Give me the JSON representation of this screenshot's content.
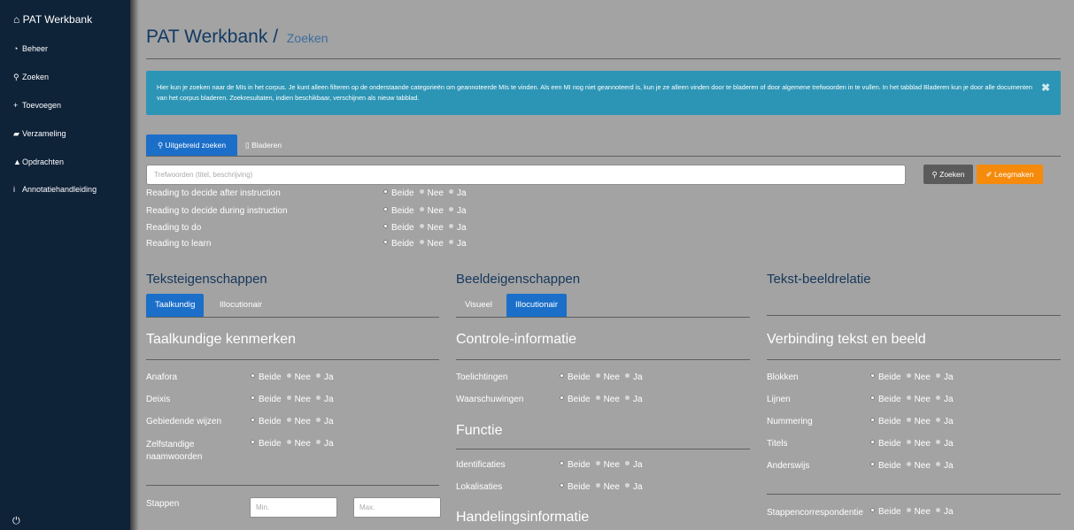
{
  "sidebar": {
    "brand": "PAT Werkbank",
    "items": [
      {
        "icon": "home-icon",
        "glyph": "🏠",
        "label": "PAT Werkbank"
      },
      {
        "icon": "dashboard-icon",
        "label": "Beheer"
      },
      {
        "icon": "search-icon",
        "label": "Zoeken"
      },
      {
        "icon": "plus-icon",
        "label": "Toevoegen"
      },
      {
        "icon": "book-icon",
        "label": "Verzameling"
      },
      {
        "icon": "graduation-cap-icon",
        "label": "Opdrachten"
      },
      {
        "icon": "info-icon",
        "label": "Annotatiehandleiding"
      }
    ],
    "power_icon": "power-icon"
  },
  "header": {
    "title": "PAT Werkbank",
    "separator": "/",
    "subtitle": "Zoeken"
  },
  "alert": {
    "text": "Hier kun je zoeken naar de MIs in het corpus. Je kunt alleen filteren op de onderstaande categorieën om geannoteerde MIs te vinden. Als een MI nog niet geannoteerd is, kun je ze alleen vinden door te bladeren of door algemene trefwoorden in te vullen. In het tabblad Bladeren kun je door alle documenten van het corpus bladeren. Zoekresultaten, indien beschikbaar, verschijnen als nieuw tabblad.",
    "close": "✖"
  },
  "tabs": {
    "advanced": "Uitgebreid zoeken",
    "browse": "Bladeren"
  },
  "search": {
    "placeholder": "Trefwoorden (titel, beschrijving)",
    "search_button": "Zoeken",
    "clear_button": "Leegmaken"
  },
  "options": {
    "both": "Beide",
    "no": "Nee",
    "yes": "Ja"
  },
  "reading_filters": [
    "Reading to decide after instruction",
    "Reading to decide during instruction",
    "Reading to do",
    "Reading to learn"
  ],
  "columns": {
    "text_props": {
      "heading": "Teksteigenschappen",
      "tabs": [
        "Taalkundig",
        "Illocutionair"
      ],
      "active_tab": "Taalkundig",
      "subheading": "Taalkundige kenmerken",
      "rows": [
        "Anafora",
        "Deixis",
        "Gebiedende wijzen",
        "Zelfstandige naamwoorden"
      ],
      "steps_label": "Stappen",
      "min_placeholder": "Min.",
      "max_placeholder": "Max."
    },
    "image_props": {
      "heading": "Beeldeigenschappen",
      "tabs": [
        "Visueel",
        "Illocutionair"
      ],
      "active_tab": "Illocutionair",
      "sub1": "Controle-informatie",
      "rows1": [
        "Toelichtingen",
        "Waarschuwingen"
      ],
      "sub2": "Functie",
      "rows2": [
        "Identificaties",
        "Lokalisaties"
      ],
      "sub3": "Handelingsinformatie"
    },
    "text_image": {
      "heading": "Tekst-beeldrelatie",
      "subheading": "Verbinding tekst en beeld",
      "rows": [
        "Blokken",
        "Lijnen",
        "Nummering",
        "Titels",
        "Anderswijs"
      ],
      "extra_row": "Stappencorrespondentie"
    }
  },
  "colors": {
    "sidebar": "#0e2238",
    "background": "#a3a3a3",
    "alert": "#2c95b5",
    "primary": "#1b6fc9",
    "warning": "#f58a0b",
    "heading": "#16375c"
  }
}
